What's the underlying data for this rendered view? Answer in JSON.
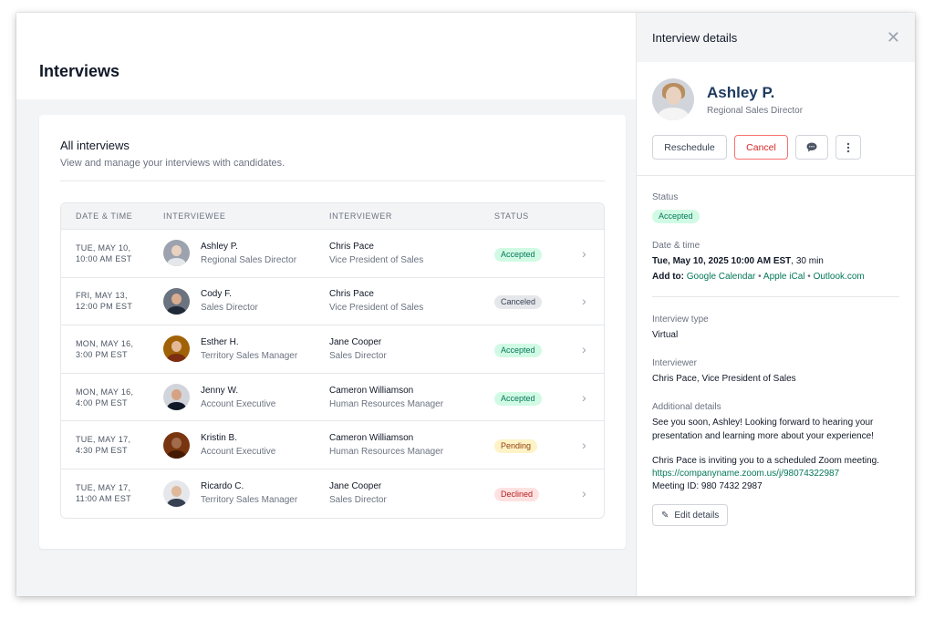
{
  "page": {
    "title": "Interviews"
  },
  "card": {
    "title": "All interviews",
    "subtitle": "View and manage your interviews with candidates."
  },
  "table": {
    "headers": {
      "date": "DATE & TIME",
      "interviewee": "INTERVIEWEE",
      "interviewer": "INTERVIEWER",
      "status": "STATUS"
    },
    "rows": [
      {
        "date1": "TUE, MAY 10,",
        "date2": "10:00 AM EST",
        "ee_name": "Ashley P.",
        "ee_role": "Regional Sales Director",
        "er_name": "Chris Pace",
        "er_role": "Vice President of Sales",
        "status": "Accepted"
      },
      {
        "date1": "FRI, MAY 13,",
        "date2": "12:00 PM EST",
        "ee_name": "Cody F.",
        "ee_role": "Sales Director",
        "er_name": "Chris Pace",
        "er_role": "Vice President of Sales",
        "status": "Canceled"
      },
      {
        "date1": "MON, MAY 16,",
        "date2": "3:00 PM EST",
        "ee_name": "Esther H.",
        "ee_role": "Territory Sales Manager",
        "er_name": "Jane Cooper",
        "er_role": "Sales Director",
        "status": "Accepted"
      },
      {
        "date1": "MON, MAY 16,",
        "date2": "4:00 PM EST",
        "ee_name": "Jenny W.",
        "ee_role": "Account Executive",
        "er_name": "Cameron Williamson",
        "er_role": "Human Resources Manager",
        "status": "Accepted"
      },
      {
        "date1": "TUE, MAY 17,",
        "date2": "4:30 PM EST",
        "ee_name": "Kristin B.",
        "ee_role": "Account Executive",
        "er_name": "Cameron Williamson",
        "er_role": "Human Resources Manager",
        "status": "Pending"
      },
      {
        "date1": "TUE, MAY 17,",
        "date2": "11:00 AM EST",
        "ee_name": "Ricardo C.",
        "ee_role": "Territory Sales Manager",
        "er_name": "Jane Cooper",
        "er_role": "Sales Director",
        "status": "Declined"
      }
    ]
  },
  "status_colors": {
    "Accepted": {
      "bg": "#d1fae5",
      "fg": "#047857"
    },
    "Canceled": {
      "bg": "#e5e7eb",
      "fg": "#374151"
    },
    "Pending": {
      "bg": "#fef3c7",
      "fg": "#92400e"
    },
    "Declined": {
      "bg": "#fee2e2",
      "fg": "#b91c1c"
    }
  },
  "panel": {
    "title": "Interview details",
    "name": "Ashley P.",
    "role": "Regional Sales Director",
    "buttons": {
      "reschedule": "Reschedule",
      "cancel": "Cancel"
    },
    "status_label": "Status",
    "status_value": "Accepted",
    "datetime_label": "Date & time",
    "datetime_bold": "Tue, May 10, 2025 10:00 AM EST",
    "datetime_rest": ", 30 min",
    "add_to": "Add to:",
    "cal_links": [
      "Google Calendar",
      "Apple iCal",
      "Outlook.com"
    ],
    "type_label": "Interview type",
    "type_value": "Virtual",
    "interviewer_label": "Interviewer",
    "interviewer_value": "Chris Pace, Vice President of Sales",
    "details_label": "Additional details",
    "details_p1": "See you soon, Ashley! Looking forward to hearing your presentation and learning more about your experience!",
    "details_p2": "Chris Pace is inviting you to a scheduled Zoom meeting.",
    "zoom_link": "https://companyname.zoom.us/j/98074322987",
    "meeting_id": "Meeting ID: 980 7432 2987",
    "edit_button": "Edit details"
  }
}
